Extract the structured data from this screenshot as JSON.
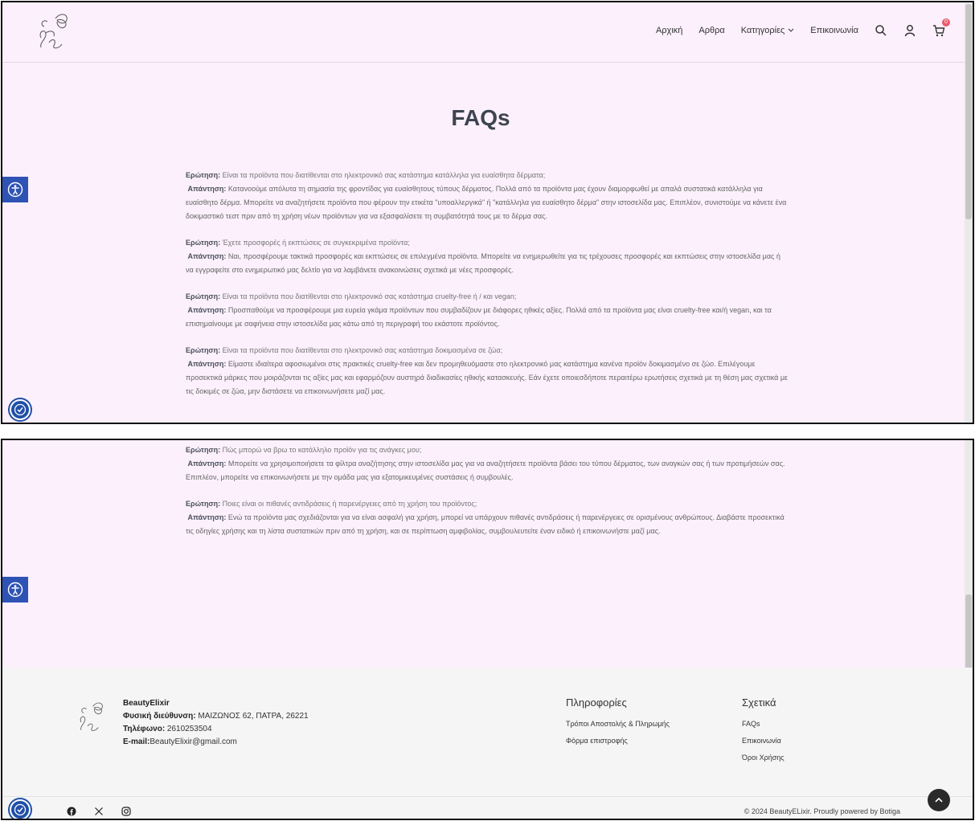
{
  "header": {
    "nav": [
      "Αρχική",
      "Αρθρα",
      "Κατηγορίες",
      "Επικοινωνία"
    ],
    "cart_count": "0"
  },
  "page": {
    "title": "FAQs"
  },
  "faqs_top": [
    {
      "q_label": "Ερώτηση:",
      "q": " Είναι τα προϊόντα που διατίθενται στο ηλεκτρονικό σας κατάστημα κατάλληλα για ευαίσθητα δέρματα;",
      "a_label": "Απάντηση:",
      "a": " Κατανοούμε απόλυτα τη σημασία της φροντίδας για ευαίσθητους τύπους δέρματος. Πολλά από τα προϊόντα μας έχουν διαμορφωθεί με απαλά συστατικά κατάλληλα για ευαίσθητο δέρμα. Μπορείτε να αναζητήσετε προϊόντα που φέρουν την ετικέτα \"υποαλλεργικά\" ή \"κατάλληλα για ευαίσθητο δέρμα\" στην ιστοσελίδα μας. Επιπλέον, συνιστούμε να κάνετε ένα δοκιμαστικό τεστ πριν από τη χρήση νέων προϊόντων για να εξασφαλίσετε τη συμβατότητά τους με το δέρμα σας."
    },
    {
      "q_label": "Ερώτηση:",
      "q": " Έχετε προσφορές ή εκπτώσεις σε συγκεκριμένα προϊόντα;",
      "a_label": "Απάντηση:",
      "a": " Ναι, προσφέρουμε τακτικά προσφορές και εκπτώσεις σε επιλεγμένα προϊόντα. Μπορείτε να ενημερωθείτε για τις τρέχουσες προσφορές και εκπτώσεις στην ιστοσελίδα μας ή να εγγραφείτε στο ενημερωτικό μας δελτίο για να λαμβάνετε ανακοινώσεις σχετικά με νέες προσφορές."
    },
    {
      "q_label": "Ερώτηση:",
      "q": " Είναι τα προϊόντα που διατίθενται στο ηλεκτρονικό σας κατάστημα cruelty-free ή / και vegan;",
      "a_label": "Απάντηση:",
      "a": " Προσπαθούμε να προσφέρουμε μια ευρεία γκάμα προϊόντων που συμβαδίζουν με διάφορες ηθικές αξίες. Πολλά από τα προϊόντα μας είναι cruelty-free και/ή vegan, και τα επισημαίνουμε με σαφήνεια στην ιστοσελίδα μας κάτω από τη περιγραφή του εκάστοτε προϊόντος."
    },
    {
      "q_label": "Ερώτηση:",
      "q": "  Είναι τα προϊόντα που διατίθενται στο ηλεκτρονικό σας κατάστημα δοκιμασμένα σε ζώα;",
      "a_label": "Απάντηση:",
      "a": " Είμαστε ιδιαίτερα αφοσιωμένοι στις πρακτικές cruelty-free και δεν προμηθευόμαστε στο ηλεκτρονικό μας κατάστημα κανένα προϊόν δοκιμασμένο σε ζώο. Επιλέγουμε προσεκτικά μάρκες που μοιράζονται τις αξίες μας και εφαρμόζουν αυστηρά διαδικασίες ηθικής κατασκευής. Εάν έχετε οποιεσδήποτε περαιτέρω ερωτήσεις σχετικά με τη θέση μας σχετικά με τις δοκιμές σε ζώα, μην διστάσετε να επικοινωνήσετε μαζί μας."
    }
  ],
  "faqs_bottom": [
    {
      "q_label": "Ερώτηση:",
      "q": " Πώς μπορώ να βρω το κατάλληλο προϊόν για τις ανάγκες μου;",
      "a_label": "Απάντηση:",
      "a": " Μπορείτε να χρησιμοποιήσετε τα φίλτρα αναζήτησης στην ιστοσελίδα μας για να αναζητήσετε προϊόντα βάσει του τύπου δέρματος, των αναγκών σας ή των προτιμήσεών σας. Επιπλέον, μπορείτε να επικοινωνήσετε με την ομάδα μας για εξατομικευμένες συστάσεις ή συμβουλές."
    },
    {
      "q_label": "Ερώτηση:",
      "q": " Ποιες είναι οι πιθανές αντιδράσεις ή παρενέργειες από τη χρήση του προϊόντος;",
      "a_label": "Απάντηση:",
      "a": " Ενώ τα προϊόντα μας σχεδιάζονται για να είναι ασφαλή για χρήση, μπορεί να υπάρχουν πιθανές αντιδράσεις ή παρενέργειες σε ορισμένους ανθρώπους. Διαβάστε προσεκτικά τις οδηγίες χρήσης και τη λίστα συστατικών πριν από τη χρήση, και σε περίπτωση αμφιβολίας, συμβουλευτείτε έναν ειδικό ή επικοινωνήστε μαζί μας."
    }
  ],
  "footer": {
    "brand": "BeautyElixir",
    "address_label": "Φυσική διεύθυνση:",
    "address": " ΜΑΙΖΩΝΟΣ 62, ΠΑΤΡΑ, 26221",
    "phone_label": "Τηλέφωνο:",
    "phone": " 2610253504",
    "email_label": "E-mail:",
    "email": "BeautyElixir@gmail.com",
    "info_title": "Πληροφορίες",
    "info_links": [
      "Τρόποι Αποστολής & Πληρωμής",
      "Φόρμα επιστροφής"
    ],
    "about_title": "Σχετικά",
    "about_links": [
      "FAQs",
      "Επικοινωνία",
      "Όροι Χρήσης"
    ],
    "copyright": "© 2024 BeautyELixir. Proudly powered by Botiga"
  },
  "icons": {
    "search": "search-icon",
    "account": "user-icon",
    "cart": "cart-icon",
    "accessibility": "accessibility-icon",
    "back_to_top": "chevron-up-icon",
    "social": [
      "facebook-icon",
      "x-icon",
      "instagram-icon"
    ]
  },
  "colors": {
    "background": "#fbf0fb",
    "accent": "#2f53b5",
    "badge": "#e85a6a"
  }
}
